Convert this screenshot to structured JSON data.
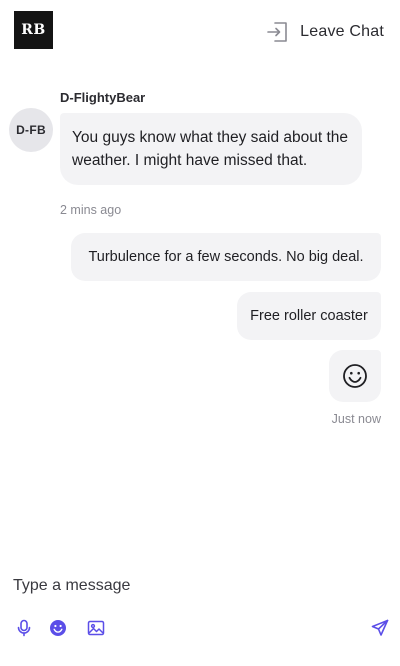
{
  "header": {
    "logo_text": "RB",
    "leave_label": "Leave Chat",
    "leave_icon": "exit-icon"
  },
  "messages": {
    "incoming": {
      "sender": "D-FlightyBear",
      "avatar_initials": "D-FB",
      "text": "You guys know what they said about the weather. I might have missed that.",
      "time": "2 mins ago"
    },
    "outgoing": [
      {
        "text": "Turbulence for a few seconds. No big deal."
      },
      {
        "text": "Free roller coaster"
      },
      {
        "emoji": "smiley-face-icon"
      }
    ],
    "outgoing_time": "Just now"
  },
  "composer": {
    "placeholder": "Type a message",
    "value": "",
    "tools": [
      "microphone-icon",
      "emoji-icon",
      "image-icon"
    ],
    "send_icon": "send-icon"
  },
  "colors": {
    "accent": "#5b4ee8",
    "bubble_bg": "#f3f3f5",
    "avatar_bg": "#e6e6ea",
    "muted_text": "#8a8a92",
    "logo_bg": "#141414"
  }
}
